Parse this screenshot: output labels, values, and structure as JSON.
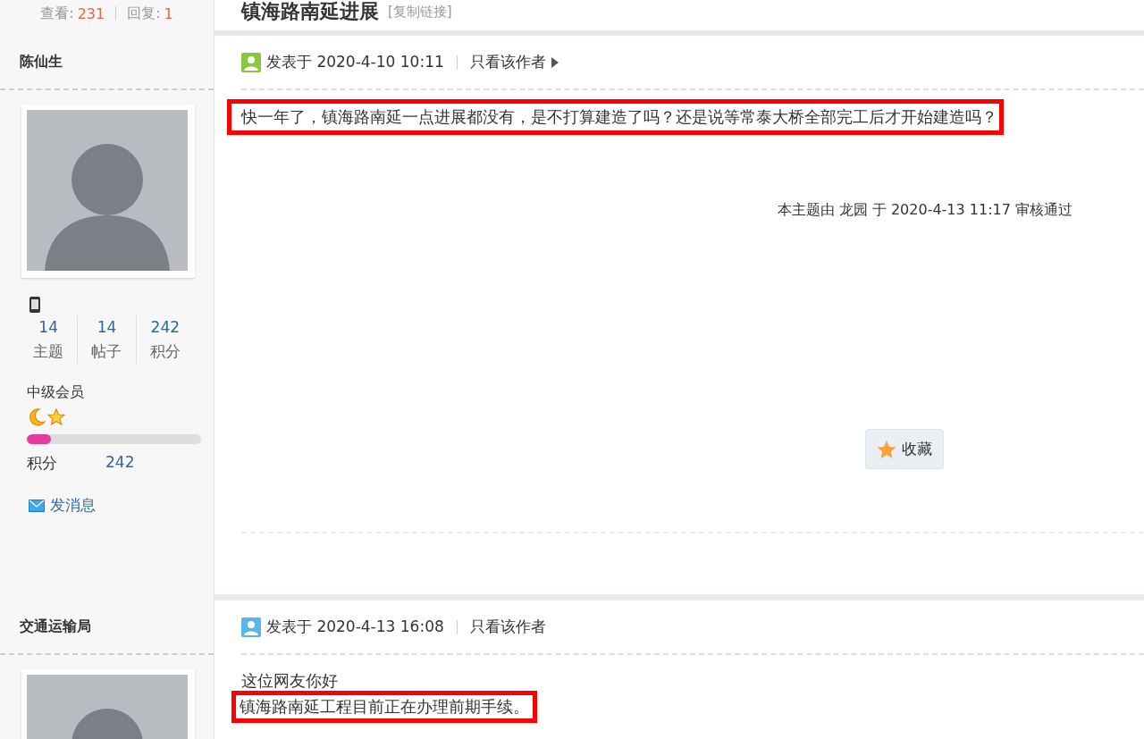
{
  "thread": {
    "views_label": "查看:",
    "views": "231",
    "replies_label": "回复:",
    "replies": "1",
    "title": "镇海路南延进展",
    "copy_link": "[复制链接]"
  },
  "posts": [
    {
      "author": {
        "name": "陈仙生",
        "profile": {
          "stats": [
            {
              "value": "14",
              "label": "主题"
            },
            {
              "value": "14",
              "label": "帖子"
            },
            {
              "value": "242",
              "label": "积分"
            }
          ],
          "rank": "中级会员",
          "level": 0.14,
          "points_label": "积分",
          "points_value": "242",
          "message_link": "发消息"
        }
      },
      "header": {
        "color": "#8cc63f",
        "posted": "发表于 2020-4-10 10:11",
        "author_only": "只看该作者",
        "show_arrow": true
      },
      "body": [
        {
          "text": "快一年了，镇海路南延一点进展都没有，是不打算建造了吗？还是说等常泰大桥全部完工后才开始建造吗？",
          "highlighted": true
        }
      ],
      "moderation_note": "本主题由 龙园 于 2020-4-13 11:17 审核通过",
      "favorite_button": "收藏"
    },
    {
      "author": {
        "name": "交通运输局"
      },
      "header": {
        "color": "#5bb5e6",
        "posted": "发表于 2020-4-13 16:08",
        "author_only": "只看该作者",
        "show_arrow": false
      },
      "body": [
        {
          "text": "这位网友你好",
          "highlighted": false
        },
        {
          "text": "镇海路南延工程目前正在办理前期手续。",
          "highlighted": true
        }
      ]
    }
  ]
}
